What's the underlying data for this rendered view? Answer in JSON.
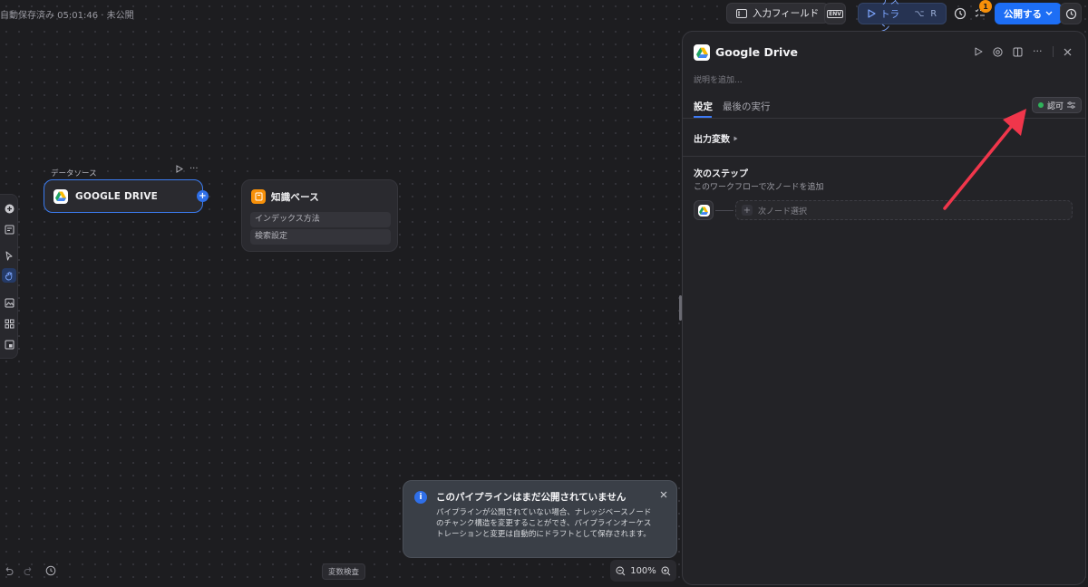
{
  "header": {
    "autosave": "自動保存済み 05:01:46 · 未公開",
    "input_field_label": "入力フィールド",
    "env_label": "ENV",
    "testrun_label": "テストラン",
    "testrun_shortcut_1": "⌥",
    "testrun_shortcut_2": "R",
    "checklist_badge": "1",
    "publish_label": "公開する"
  },
  "canvas": {
    "datasource_label": "データソース",
    "gdrive_node_title": "GOOGLE DRIVE",
    "kb_node_title": "知識ベース",
    "kb_rows": [
      "インデックス方法",
      "検索設定"
    ]
  },
  "bottom": {
    "variable_inspect": "変数検査",
    "zoom": "100%"
  },
  "toast": {
    "title": "このパイプラインはまだ公開されていません",
    "body": "パイプラインが公開されていない場合、ナレッジベースノードのチャンク構造を変更することができ、パイプラインオーケストレーションと変更は自動的にドラフトとして保存されます。"
  },
  "panel": {
    "title": "Google Drive",
    "description_placeholder": "説明を追加...",
    "tabs": [
      "設定",
      "最後の実行"
    ],
    "auth_label": "認可",
    "output_vars": "出力変数",
    "next_step_title": "次のステップ",
    "next_step_sub": "このワークフローで次ノードを追加",
    "next_node_select": "次ノード選択"
  },
  "colors": {
    "accent": "#1d6ef5",
    "arrow": "#f0364b",
    "auth_dot": "#2fb35a",
    "badge": "#f79009"
  }
}
